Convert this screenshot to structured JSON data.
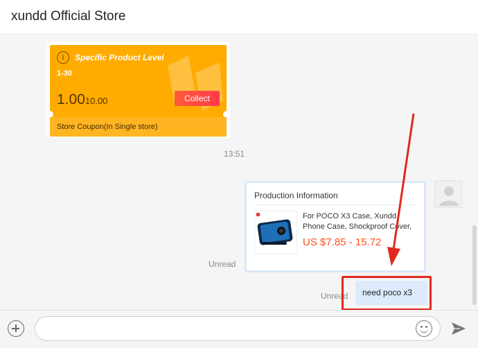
{
  "header": {
    "title": "xundd Official Store"
  },
  "coupon": {
    "level_label": "Specific Product Level",
    "range": "1-30",
    "amount": "1.00",
    "threshold": "10.00",
    "collect_label": "Collect",
    "footer": "Store Coupon(In Single store)"
  },
  "chat": {
    "timestamp": "13:51",
    "product_card": {
      "title": "Production Information",
      "product_name": "For POCO X3 Case, Xundd Phone Case, Shockproof Cover, F...",
      "price": "US $7.85 - 15.72",
      "status": "Unread"
    },
    "message": {
      "text": "need poco x3",
      "status": "Unread"
    }
  },
  "input": {
    "placeholder": ""
  },
  "colors": {
    "coupon": "#ffab00",
    "collect": "#ff4a44",
    "price": "#ff4f1a",
    "bubble": "#dceafc",
    "annotation": "#e0281e"
  },
  "icons": {
    "info": "info-icon",
    "avatar": "user-avatar-icon",
    "add": "plus-circle-icon",
    "emoji": "smiley-icon",
    "send": "paper-plane-icon"
  }
}
